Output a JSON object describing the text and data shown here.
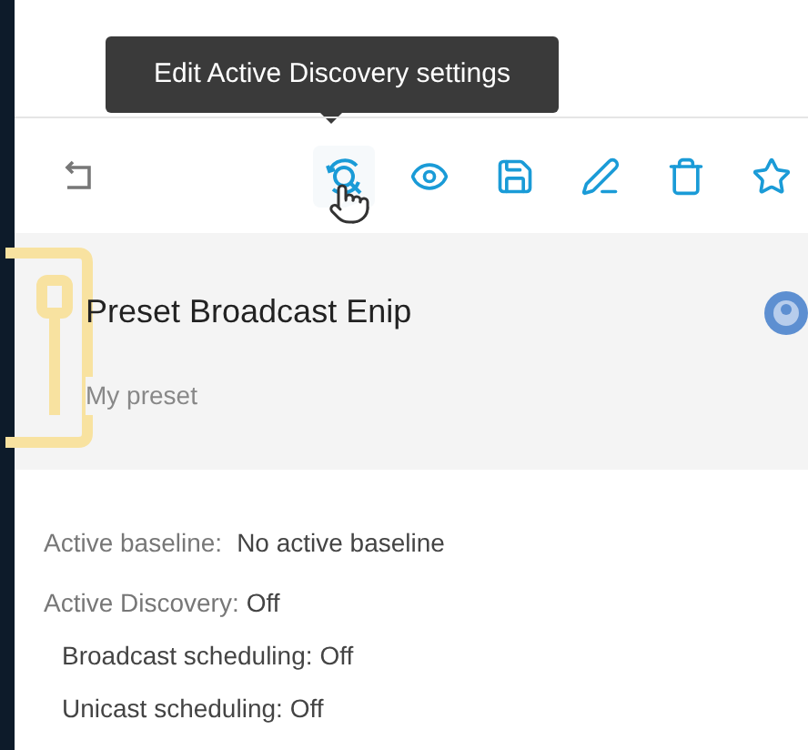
{
  "tooltip": {
    "text": "Edit Active Discovery settings"
  },
  "toolbar": [
    {
      "kind": "back",
      "hovered": false
    },
    {
      "kind": "discovery",
      "hovered": true
    },
    {
      "kind": "watch",
      "hovered": false
    },
    {
      "kind": "save",
      "hovered": false
    },
    {
      "kind": "edit",
      "hovered": false
    },
    {
      "kind": "delete",
      "hovered": false
    },
    {
      "kind": "favorite",
      "hovered": false
    }
  ],
  "preset": {
    "title": "Preset Broadcast Enip",
    "subtitle": "My preset"
  },
  "details": [
    {
      "label": "Active baseline:",
      "value": "No active baseline",
      "indent": false
    },
    {
      "label": "Active Discovery:",
      "value": "Off",
      "indent": false
    },
    {
      "label": "Broadcast scheduling:",
      "value": "Off",
      "indent": true
    },
    {
      "label": "Unicast scheduling:",
      "value": "Off",
      "indent": true
    }
  ]
}
